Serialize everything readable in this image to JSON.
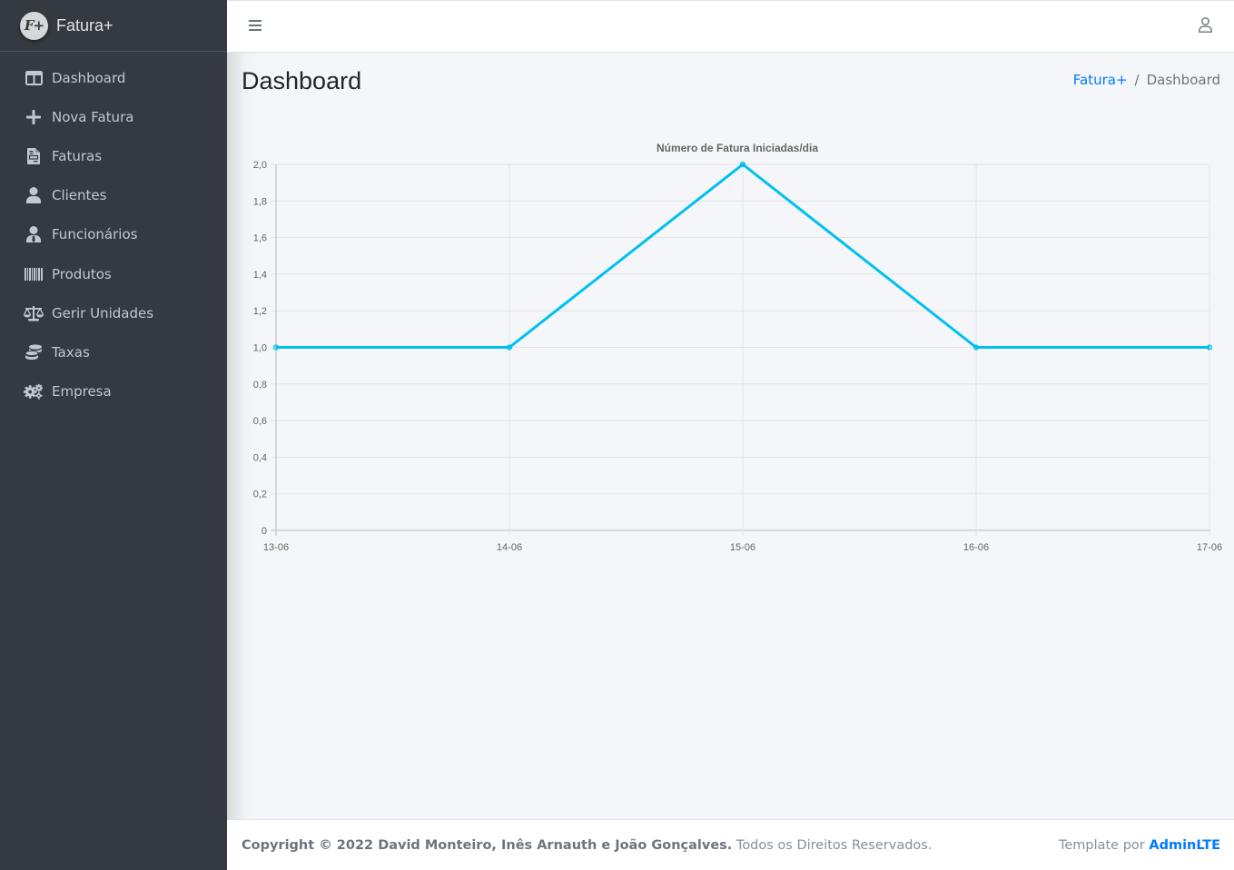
{
  "app": {
    "name": "Fatura+",
    "logo_text": "F+"
  },
  "sidebar": {
    "items": [
      {
        "label": "Dashboard",
        "icon": "columns-icon"
      },
      {
        "label": "Nova Fatura",
        "icon": "plus-icon"
      },
      {
        "label": "Faturas",
        "icon": "file-invoice-icon"
      },
      {
        "label": "Clientes",
        "icon": "user-icon"
      },
      {
        "label": "Funcionários",
        "icon": "user-tie-icon"
      },
      {
        "label": "Produtos",
        "icon": "barcode-icon"
      },
      {
        "label": "Gerir Unidades",
        "icon": "balance-scale-icon"
      },
      {
        "label": "Taxas",
        "icon": "coins-icon"
      },
      {
        "label": "Empresa",
        "icon": "cogs-icon"
      }
    ]
  },
  "header": {
    "menu_icon": "hamburger-icon",
    "user_icon": "user-outline-icon"
  },
  "page": {
    "title": "Dashboard",
    "breadcrumb": {
      "link": "Fatura+",
      "separator": "/",
      "current": "Dashboard"
    }
  },
  "chart_data": {
    "type": "line",
    "title": "Número de Fatura Iniciadas/dia",
    "categories": [
      "13-06",
      "14-06",
      "15-06",
      "16-06",
      "17-06"
    ],
    "series": [
      {
        "values": [
          1,
          1,
          2,
          1,
          1
        ],
        "color": "#00c0ef"
      }
    ],
    "ylim": [
      0,
      2
    ],
    "yticks": [
      "0",
      "0,2",
      "0,4",
      "0,6",
      "0,8",
      "1,0",
      "1,2",
      "1,4",
      "1,6",
      "1,8",
      "2,0"
    ],
    "grid": true
  },
  "footer": {
    "copyright": "Copyright © 2022 David Monteiro, Inês Arnauth e João Gonçalves.",
    "rights": " Todos os Direitos Reservados.",
    "template_prefix": "Template por ",
    "template_link": "AdminLTE"
  },
  "colors": {
    "sidebar": "#343a40",
    "accent": "#007bff",
    "line": "#00c0ef"
  }
}
